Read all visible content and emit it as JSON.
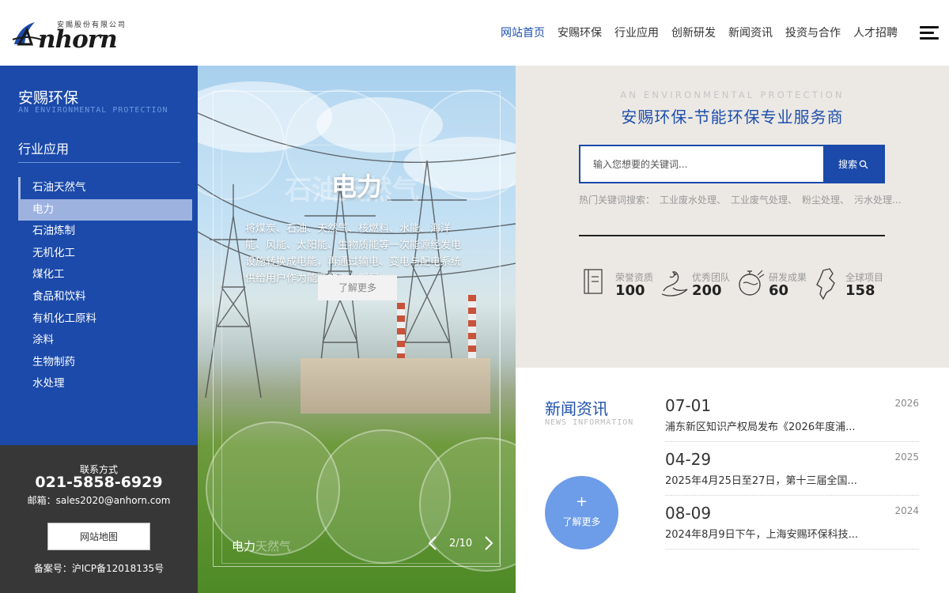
{
  "header": {
    "logo": {
      "tagline": "安赐股份有限公司",
      "wordmark": "nhorn"
    },
    "nav": [
      {
        "label": "网站首页",
        "active": true
      },
      {
        "label": "安赐环保"
      },
      {
        "label": "行业应用"
      },
      {
        "label": "创新研发"
      },
      {
        "label": "新闻资讯"
      },
      {
        "label": "投资与合作"
      },
      {
        "label": "人才招聘"
      }
    ],
    "menu_icon": "hamburger-icon"
  },
  "sidebar": {
    "title": "安赐环保",
    "subtitle": "AN ENVIRONMENTAL PROTECTION",
    "section_title": "行业应用",
    "items": [
      {
        "label": "石油天然气"
      },
      {
        "label": "电力",
        "active": true
      },
      {
        "label": "石油炼制"
      },
      {
        "label": "无机化工"
      },
      {
        "label": "煤化工"
      },
      {
        "label": "食品和饮料"
      },
      {
        "label": "有机化工原料"
      },
      {
        "label": "涂料"
      },
      {
        "label": "生物制药"
      },
      {
        "label": "水处理"
      }
    ],
    "contact": {
      "label": "联系方式",
      "phone": "021-5858-6929",
      "email": "邮箱：sales2020@anhorn.com",
      "sitemap_button": "网站地图",
      "icp": "备案号：沪ICP备12018135号"
    }
  },
  "slide": {
    "ghost_title": "石油天然气",
    "title": "电力",
    "description": "将煤炭、石油、天然气、核燃料、水能、海洋能、风能、太阳能、生物质能等一次能源经发电设施转换成电能，再通过输电、变电与配电系统供给用户作为能源的工业部门。",
    "button": "了解更多",
    "caption": "电力",
    "caption_ghost": "天然气",
    "pager": {
      "current": 2,
      "total": 10,
      "text": "2/10"
    }
  },
  "promo": {
    "en": "AN ENVIRONMENTAL PROTECTION",
    "cn": "安赐环保-节能环保专业服务商",
    "search_placeholder": "输入您想要的关键词...",
    "search_button": "搜索",
    "hot_label": "热门关键词搜索：",
    "hot_keywords": [
      "工业废水处理、",
      "工业废气处理、",
      "粉尘处理、",
      "污水处理..."
    ],
    "stats": [
      {
        "label": "荣誉资质",
        "value": "100",
        "icon": "certificate-icon"
      },
      {
        "label": "优秀团队",
        "value": "200",
        "icon": "team-icon"
      },
      {
        "label": "研发成果",
        "value": "60",
        "icon": "flask-icon"
      },
      {
        "label": "全球项目",
        "value": "158",
        "icon": "map-icon"
      }
    ]
  },
  "news": {
    "title": "新闻资讯",
    "subtitle": "NEWS INFORMATION",
    "more_plus": "+",
    "more_label": "了解更多",
    "items": [
      {
        "date": "07-01",
        "year": "2026",
        "title": "浦东新区知识产权局发布《2026年度浦..."
      },
      {
        "date": "04-29",
        "year": "2025",
        "title": "2025年4月25日至27日，第十三届全国..."
      },
      {
        "date": "08-09",
        "year": "2024",
        "title": "2024年8月9日下午，上海安赐环保科技..."
      }
    ]
  },
  "colors": {
    "brand_blue": "#1b4aaa",
    "accent_blue": "#1e4fae",
    "sidebar_active": "#9eb2e0",
    "contact_bg": "#373737",
    "promo_bg": "#ece9e4"
  }
}
